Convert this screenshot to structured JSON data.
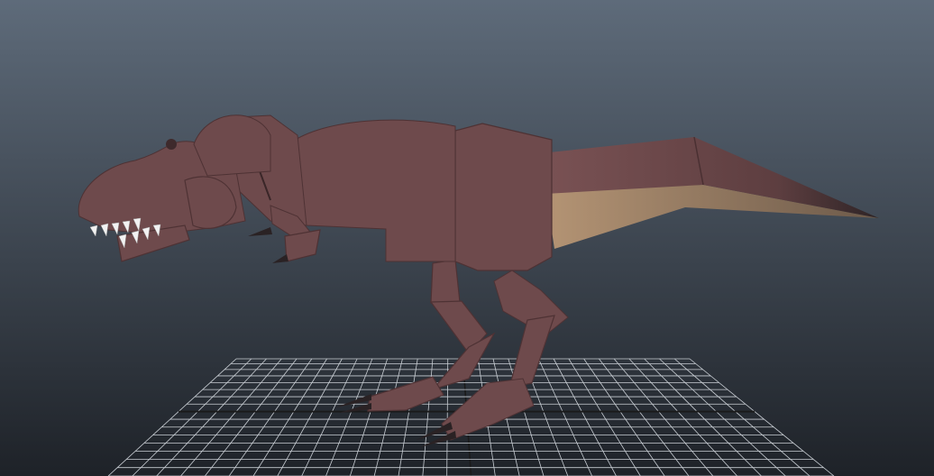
{
  "viewport": {
    "background_top": "#5e6b7a",
    "background_bottom": "#1e2228",
    "grid_color": "#c9ced4",
    "axis_color": "#1a1a1a"
  },
  "model": {
    "body_color": "#6e4a4c",
    "body_light": "#7c5456",
    "body_dark": "#4e3234",
    "belly_color": "#a98a6a",
    "teeth_color": "#f2f2f2",
    "claw_color": "#2a2224"
  }
}
